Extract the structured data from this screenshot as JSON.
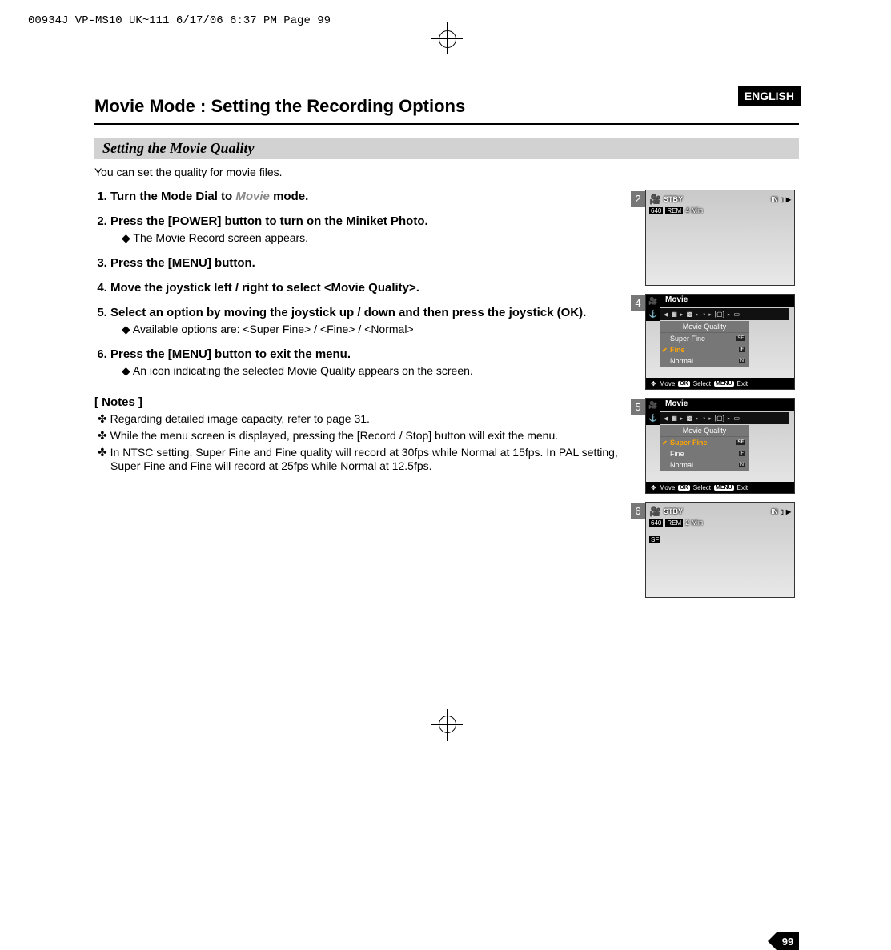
{
  "print": {
    "header": "00934J VP-MS10 UK~111  6/17/06 6:37 PM  Page 99"
  },
  "page": {
    "language_badge": "ENGLISH",
    "title": "Movie Mode : Setting the Recording Options",
    "subtitle": "Setting the Movie Quality",
    "intro": "You can set the quality for movie files.",
    "number": "99"
  },
  "steps": [
    {
      "text_pre": "Turn the Mode Dial to ",
      "text_mode": "Movie",
      "text_post": " mode."
    },
    {
      "text": "Press the [POWER] button to turn on the Miniket Photo.",
      "bullets": [
        "The Movie Record screen appears."
      ]
    },
    {
      "text": "Press the [MENU] button."
    },
    {
      "text": "Move the joystick left / right to select <Movie Quality>."
    },
    {
      "text": "Select an option by moving the joystick up / down and then press the joystick (OK).",
      "bullets": [
        "Available options are: <Super Fine> / <Fine> / <Normal>"
      ]
    },
    {
      "text": "Press the [MENU] button to exit the menu.",
      "bullets": [
        "An icon indicating the selected Movie Quality appears on the screen."
      ]
    }
  ],
  "notes": {
    "heading": "[ Notes ]",
    "items": [
      "Regarding detailed image capacity, refer to page 31.",
      "While the menu screen is displayed, pressing the [Record / Stop] button will exit the menu.",
      "In NTSC setting, Super Fine and Fine quality will record at 30fps while Normal at 15fps. In PAL setting, Super Fine and Fine will record at 25fps while Normal at 12.5fps."
    ]
  },
  "figures": {
    "fig2": {
      "num": "2",
      "stby": "STBY",
      "res": "640",
      "rem_label": "REM",
      "rem_time": "4 Min",
      "in": "IN"
    },
    "fig4": {
      "num": "4",
      "title": "Movie",
      "panel_title": "Movie Quality",
      "opts": [
        "Super Fine",
        "Fine",
        "Normal"
      ],
      "selected_index": 1,
      "footer": {
        "move": "Move",
        "ok": "OK",
        "select": "Select",
        "menu": "MENU",
        "exit": "Exit"
      }
    },
    "fig5": {
      "num": "5",
      "title": "Movie",
      "panel_title": "Movie Quality",
      "opts": [
        "Super Fine",
        "Fine",
        "Normal"
      ],
      "selected_index": 0,
      "footer": {
        "move": "Move",
        "ok": "OK",
        "select": "Select",
        "menu": "MENU",
        "exit": "Exit"
      }
    },
    "fig6": {
      "num": "6",
      "stby": "STBY",
      "res": "640",
      "sf": "SF",
      "rem_label": "REM",
      "rem_time": "2 Min",
      "in": "IN"
    }
  }
}
